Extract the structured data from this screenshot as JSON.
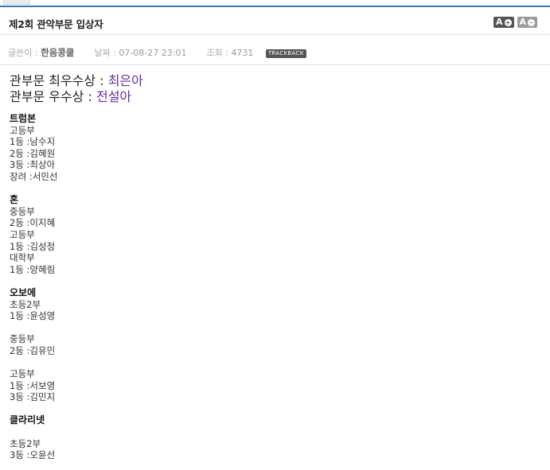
{
  "post": {
    "title": "제2회 관악부문 입상자",
    "font_up_label": "A",
    "font_down_label": "A",
    "font_up_sign": "+",
    "font_down_sign": "−"
  },
  "meta": {
    "author_label": "글쓴이 : ",
    "author": "한음콩쿨",
    "date_label": "날짜 : ",
    "date": "07-08-27 23:01",
    "views_label": "조회 : ",
    "views": "4731",
    "trackback_label": "TRACKBACK"
  },
  "awards": [
    {
      "label": "관부문 최우수상 : ",
      "name": "최은아"
    },
    {
      "label": "관부문 우수상 : ",
      "name": "전설아"
    }
  ],
  "lines": [
    {
      "text": "트럼본",
      "type": "head"
    },
    {
      "text": "고등부"
    },
    {
      "text": "1등 :남수지"
    },
    {
      "text": "2등 :김혜원"
    },
    {
      "text": "3등 :최상아"
    },
    {
      "text": "장려 :서민선"
    },
    {
      "text": ""
    },
    {
      "text": "혼",
      "type": "head"
    },
    {
      "text": "중등부"
    },
    {
      "text": "2등 :이지혜"
    },
    {
      "text": "고등부"
    },
    {
      "text": "1등 :김성정"
    },
    {
      "text": "대학부"
    },
    {
      "text": "1등 :양혜림"
    },
    {
      "text": ""
    },
    {
      "text": "오보에",
      "type": "head"
    },
    {
      "text": "초등2부"
    },
    {
      "text": "1등 :윤성영"
    },
    {
      "text": ""
    },
    {
      "text": "중등부"
    },
    {
      "text": "2등 :김유민"
    },
    {
      "text": ""
    },
    {
      "text": "고등부"
    },
    {
      "text": "1등 :서보영"
    },
    {
      "text": "3등 :김민지"
    },
    {
      "text": ""
    },
    {
      "text": "클라리넷",
      "type": "head"
    },
    {
      "text": ""
    },
    {
      "text": "초등2부"
    },
    {
      "text": "3등 :오윤선"
    }
  ],
  "colors": {
    "accent_rule": "#3a79a8",
    "award_name": "#6a2c9e"
  }
}
